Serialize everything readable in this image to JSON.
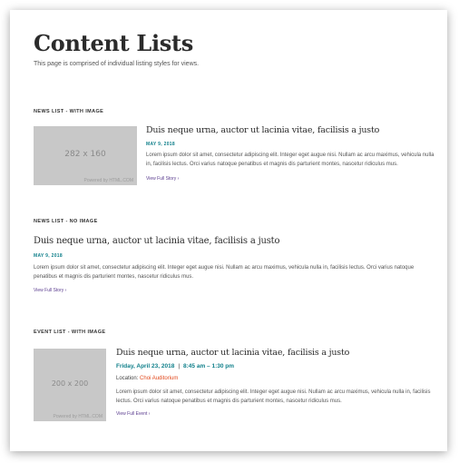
{
  "page": {
    "title": "Content Lists",
    "subtitle": "This page is comprised of individual listing styles for views."
  },
  "sections": {
    "news_with_image": {
      "label": "NEWS LIST - WITH IMAGE",
      "image_size": "282 x 160",
      "image_credit": "Powered by HTML.COM",
      "title": "Duis neque urna, auctor ut lacinia vitae, facilisis a justo",
      "date": "MAY 9, 2018",
      "body_line1": "Lorem ipsum dolor sit amet, consectetur adipiscing elit. Integer eget augue nisi. Nullam ac arcu maximus, vehicula nulla",
      "body_line2": "in, facilisis lectus. Orci varius natoque penatibus et magnis dis parturient montes, nascetur ridiculus mus.",
      "link": "View Full Story  ›"
    },
    "news_no_image": {
      "label": "NEWS LIST - NO IMAGE",
      "title": "Duis neque urna, auctor ut lacinia vitae, facilisis a justo",
      "date": "MAY 9, 2018",
      "body_line1": "Lorem ipsum dolor sit amet, consectetur adipiscing elit. Integer eget augue nisi. Nullam ac arcu maximus, vehicula nulla in, facilisis lectus. Orci varius natoque",
      "body_line2": "penatibus et magnis dis parturient montes, nascetur ridiculus mus.",
      "link": "View Full Story  ›"
    },
    "event_with_image": {
      "label": "EVENT LIST - WITH IMAGE",
      "image_size": "200 x 200",
      "image_credit": "Powered by HTML.COM",
      "title": "Duis neque urna, auctor ut lacinia vitae, facilisis a justo",
      "date": "Friday, April 23, 2018",
      "separator": "|",
      "time": "8:45 am – 1:30 pm",
      "location_label": "Location:",
      "venue": "Choi Auditorium",
      "body_line1": "Lorem ipsum dolor sit amet, consectetur adipiscing elit. Integer eget augue nisi. Nullam ac arcu maximus, vehicula nulla in, facilisis",
      "body_line2": "lectus. Orci varius natoque penatibus et magnis dis parturient montes, nascetur ridiculus mus.",
      "link": "View Full Event  ›"
    }
  },
  "colors": {
    "accent_teal": "#0f7f8a",
    "link_purple": "#5b3d8f",
    "venue_orange": "#e24b1f",
    "placeholder_gray": "#c8c8c8"
  }
}
